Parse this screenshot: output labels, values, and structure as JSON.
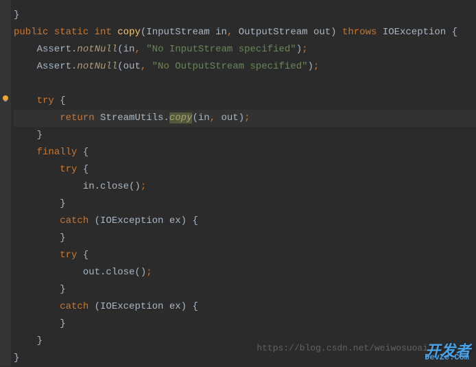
{
  "lines": {
    "l0": "}",
    "l1_public": "public",
    "l1_static": "static",
    "l1_int": "int",
    "l1_copy": "copy",
    "l1_rest1": "(InputStream in",
    "l1_comma1": ",",
    "l1_rest2": " OutputStream out)",
    "l1_throws": "throws",
    "l1_rest3": " IOException {",
    "l2_prefix": "    Assert.",
    "l2_notnull": "notNull",
    "l2_paren": "(in",
    "l2_comma": ",",
    "l2_str": "\"No InputStream specified\"",
    "l2_end": ")",
    "l2_semi": ";",
    "l3_prefix": "    Assert.",
    "l3_notnull": "notNull",
    "l3_paren": "(out",
    "l3_comma": ",",
    "l3_str": "\"No OutputStream specified\"",
    "l3_end": ")",
    "l3_semi": ";",
    "l5_try": "try",
    "l5_brace": " {",
    "l6_return": "return",
    "l6_mid": " StreamUtils.",
    "l6_copy": "copy",
    "l6_args": "(in",
    "l6_comma": ",",
    "l6_args2": " out)",
    "l6_semi": ";",
    "l7": "    }",
    "l8_finally": "finally",
    "l8_brace": " {",
    "l9_try": "try",
    "l9_brace": " {",
    "l10": "            in.close()",
    "l10_semi": ";",
    "l11": "        }",
    "l12_catch": "catch",
    "l12_rest": " (IOException ex) {",
    "l13": "        }",
    "l14_try": "try",
    "l14_brace": " {",
    "l15": "            out.close()",
    "l15_semi": ";",
    "l16": "        }",
    "l17_catch": "catch",
    "l17_rest": " (IOException ex) {",
    "l18": "        }",
    "l19": "    }",
    "l20": "}"
  },
  "watermark": {
    "url": "https://blog.csdn.net/weiwosuoai",
    "logo": "开发者",
    "sub": "DevZe.Com"
  }
}
